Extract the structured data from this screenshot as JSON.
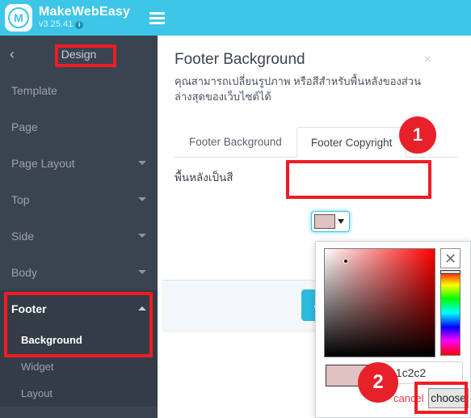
{
  "topbar": {
    "logo_letter": "M",
    "brand_name": "MakeWebEasy",
    "version": "v3.25.41",
    "info_glyph": "i",
    "menu_icon": "hamburger-icon"
  },
  "sidebar": {
    "back_label": "‹",
    "title": "Design",
    "items": [
      {
        "label": "Template",
        "expandable": false
      },
      {
        "label": "Page",
        "expandable": false
      },
      {
        "label": "Page Layout",
        "expandable": true
      },
      {
        "label": "Top",
        "expandable": true
      },
      {
        "label": "Side",
        "expandable": true
      },
      {
        "label": "Body",
        "expandable": true
      },
      {
        "label": "Footer",
        "expandable": true,
        "expanded": true
      }
    ],
    "footer_children": [
      {
        "label": "Background",
        "active": true
      },
      {
        "label": "Widget",
        "active": false
      },
      {
        "label": "Layout",
        "active": false
      }
    ]
  },
  "panel": {
    "title": "Footer Background",
    "close_label": "×",
    "description": "คุณสามารถเปลี่ยนรูปภาพ หรือสีสำหรับพื้นหลังของส่วนล่างสุดของเว็บไซต์ได้",
    "tabs": [
      {
        "label": "Footer Background",
        "active": false
      },
      {
        "label": "Footer Copyright",
        "active": true
      }
    ],
    "field_label": "พื้นหลังเป็นสี",
    "swatch_color": "#e1c2c2",
    "save_glyph": "✓"
  },
  "picker": {
    "close_glyph": "✕",
    "hex_value": "e1c2c2",
    "cancel_label": "cancel",
    "choose_label": "choose",
    "preview_color": "#e1c2c2",
    "hue_base": "#ff0000"
  },
  "annotations": {
    "badge_1": "1",
    "badge_2": "2",
    "highlight_color": "#f01c23"
  },
  "colors": {
    "brand_cyan": "#3ec6e8",
    "sidebar_bg": "#3a4350",
    "accent_red": "#e8202a"
  }
}
